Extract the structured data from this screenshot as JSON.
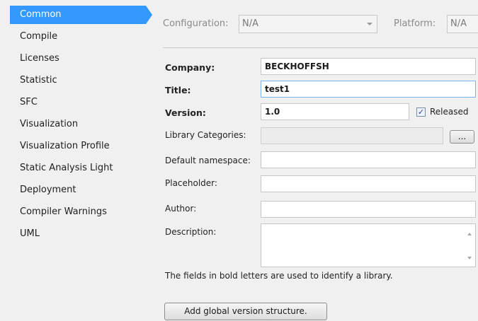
{
  "sidebar": {
    "items": [
      {
        "label": "Common",
        "active": true
      },
      {
        "label": "Compile"
      },
      {
        "label": "Licenses"
      },
      {
        "label": "Statistic"
      },
      {
        "label": "SFC"
      },
      {
        "label": "Visualization"
      },
      {
        "label": "Visualization Profile"
      },
      {
        "label": "Static Analysis Light"
      },
      {
        "label": "Deployment"
      },
      {
        "label": "Compiler Warnings"
      },
      {
        "label": "UML"
      }
    ]
  },
  "config_bar": {
    "configuration_label": "Configuration:",
    "configuration_value": "N/A",
    "platform_label": "Platform:",
    "platform_value": "N/A"
  },
  "form": {
    "company_label": "Company:",
    "company_value": "BECKHOFFSH",
    "title_label": "Title:",
    "title_value": "test1",
    "version_label": "Version:",
    "version_value": "1.0",
    "released_label": "Released",
    "released_checked": true,
    "library_categories_label": "Library Categories:",
    "library_categories_value": "",
    "browse_button_label": "...",
    "default_namespace_label": "Default namespace:",
    "default_namespace_value": "",
    "placeholder_label": "Placeholder:",
    "placeholder_value": "",
    "author_label": "Author:",
    "author_value": "",
    "description_label": "Description:",
    "description_value": ""
  },
  "note": "The fields in bold letters are used to identify a library.",
  "add_version_button_label": "Add global version structure.",
  "colors": {
    "selection": "#3399ff",
    "panel_background": "#f0f0f0"
  }
}
